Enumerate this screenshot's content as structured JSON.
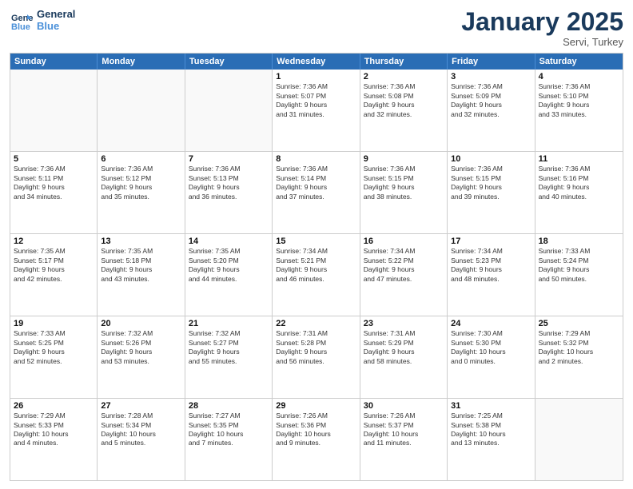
{
  "header": {
    "logo_line1": "General",
    "logo_line2": "Blue",
    "month": "January 2025",
    "location": "Servi, Turkey"
  },
  "weekdays": [
    "Sunday",
    "Monday",
    "Tuesday",
    "Wednesday",
    "Thursday",
    "Friday",
    "Saturday"
  ],
  "rows": [
    [
      {
        "day": "",
        "text": ""
      },
      {
        "day": "",
        "text": ""
      },
      {
        "day": "",
        "text": ""
      },
      {
        "day": "1",
        "text": "Sunrise: 7:36 AM\nSunset: 5:07 PM\nDaylight: 9 hours\nand 31 minutes."
      },
      {
        "day": "2",
        "text": "Sunrise: 7:36 AM\nSunset: 5:08 PM\nDaylight: 9 hours\nand 32 minutes."
      },
      {
        "day": "3",
        "text": "Sunrise: 7:36 AM\nSunset: 5:09 PM\nDaylight: 9 hours\nand 32 minutes."
      },
      {
        "day": "4",
        "text": "Sunrise: 7:36 AM\nSunset: 5:10 PM\nDaylight: 9 hours\nand 33 minutes."
      }
    ],
    [
      {
        "day": "5",
        "text": "Sunrise: 7:36 AM\nSunset: 5:11 PM\nDaylight: 9 hours\nand 34 minutes."
      },
      {
        "day": "6",
        "text": "Sunrise: 7:36 AM\nSunset: 5:12 PM\nDaylight: 9 hours\nand 35 minutes."
      },
      {
        "day": "7",
        "text": "Sunrise: 7:36 AM\nSunset: 5:13 PM\nDaylight: 9 hours\nand 36 minutes."
      },
      {
        "day": "8",
        "text": "Sunrise: 7:36 AM\nSunset: 5:14 PM\nDaylight: 9 hours\nand 37 minutes."
      },
      {
        "day": "9",
        "text": "Sunrise: 7:36 AM\nSunset: 5:15 PM\nDaylight: 9 hours\nand 38 minutes."
      },
      {
        "day": "10",
        "text": "Sunrise: 7:36 AM\nSunset: 5:15 PM\nDaylight: 9 hours\nand 39 minutes."
      },
      {
        "day": "11",
        "text": "Sunrise: 7:36 AM\nSunset: 5:16 PM\nDaylight: 9 hours\nand 40 minutes."
      }
    ],
    [
      {
        "day": "12",
        "text": "Sunrise: 7:35 AM\nSunset: 5:17 PM\nDaylight: 9 hours\nand 42 minutes."
      },
      {
        "day": "13",
        "text": "Sunrise: 7:35 AM\nSunset: 5:18 PM\nDaylight: 9 hours\nand 43 minutes."
      },
      {
        "day": "14",
        "text": "Sunrise: 7:35 AM\nSunset: 5:20 PM\nDaylight: 9 hours\nand 44 minutes."
      },
      {
        "day": "15",
        "text": "Sunrise: 7:34 AM\nSunset: 5:21 PM\nDaylight: 9 hours\nand 46 minutes."
      },
      {
        "day": "16",
        "text": "Sunrise: 7:34 AM\nSunset: 5:22 PM\nDaylight: 9 hours\nand 47 minutes."
      },
      {
        "day": "17",
        "text": "Sunrise: 7:34 AM\nSunset: 5:23 PM\nDaylight: 9 hours\nand 48 minutes."
      },
      {
        "day": "18",
        "text": "Sunrise: 7:33 AM\nSunset: 5:24 PM\nDaylight: 9 hours\nand 50 minutes."
      }
    ],
    [
      {
        "day": "19",
        "text": "Sunrise: 7:33 AM\nSunset: 5:25 PM\nDaylight: 9 hours\nand 52 minutes."
      },
      {
        "day": "20",
        "text": "Sunrise: 7:32 AM\nSunset: 5:26 PM\nDaylight: 9 hours\nand 53 minutes."
      },
      {
        "day": "21",
        "text": "Sunrise: 7:32 AM\nSunset: 5:27 PM\nDaylight: 9 hours\nand 55 minutes."
      },
      {
        "day": "22",
        "text": "Sunrise: 7:31 AM\nSunset: 5:28 PM\nDaylight: 9 hours\nand 56 minutes."
      },
      {
        "day": "23",
        "text": "Sunrise: 7:31 AM\nSunset: 5:29 PM\nDaylight: 9 hours\nand 58 minutes."
      },
      {
        "day": "24",
        "text": "Sunrise: 7:30 AM\nSunset: 5:30 PM\nDaylight: 10 hours\nand 0 minutes."
      },
      {
        "day": "25",
        "text": "Sunrise: 7:29 AM\nSunset: 5:32 PM\nDaylight: 10 hours\nand 2 minutes."
      }
    ],
    [
      {
        "day": "26",
        "text": "Sunrise: 7:29 AM\nSunset: 5:33 PM\nDaylight: 10 hours\nand 4 minutes."
      },
      {
        "day": "27",
        "text": "Sunrise: 7:28 AM\nSunset: 5:34 PM\nDaylight: 10 hours\nand 5 minutes."
      },
      {
        "day": "28",
        "text": "Sunrise: 7:27 AM\nSunset: 5:35 PM\nDaylight: 10 hours\nand 7 minutes."
      },
      {
        "day": "29",
        "text": "Sunrise: 7:26 AM\nSunset: 5:36 PM\nDaylight: 10 hours\nand 9 minutes."
      },
      {
        "day": "30",
        "text": "Sunrise: 7:26 AM\nSunset: 5:37 PM\nDaylight: 10 hours\nand 11 minutes."
      },
      {
        "day": "31",
        "text": "Sunrise: 7:25 AM\nSunset: 5:38 PM\nDaylight: 10 hours\nand 13 minutes."
      },
      {
        "day": "",
        "text": ""
      }
    ]
  ]
}
